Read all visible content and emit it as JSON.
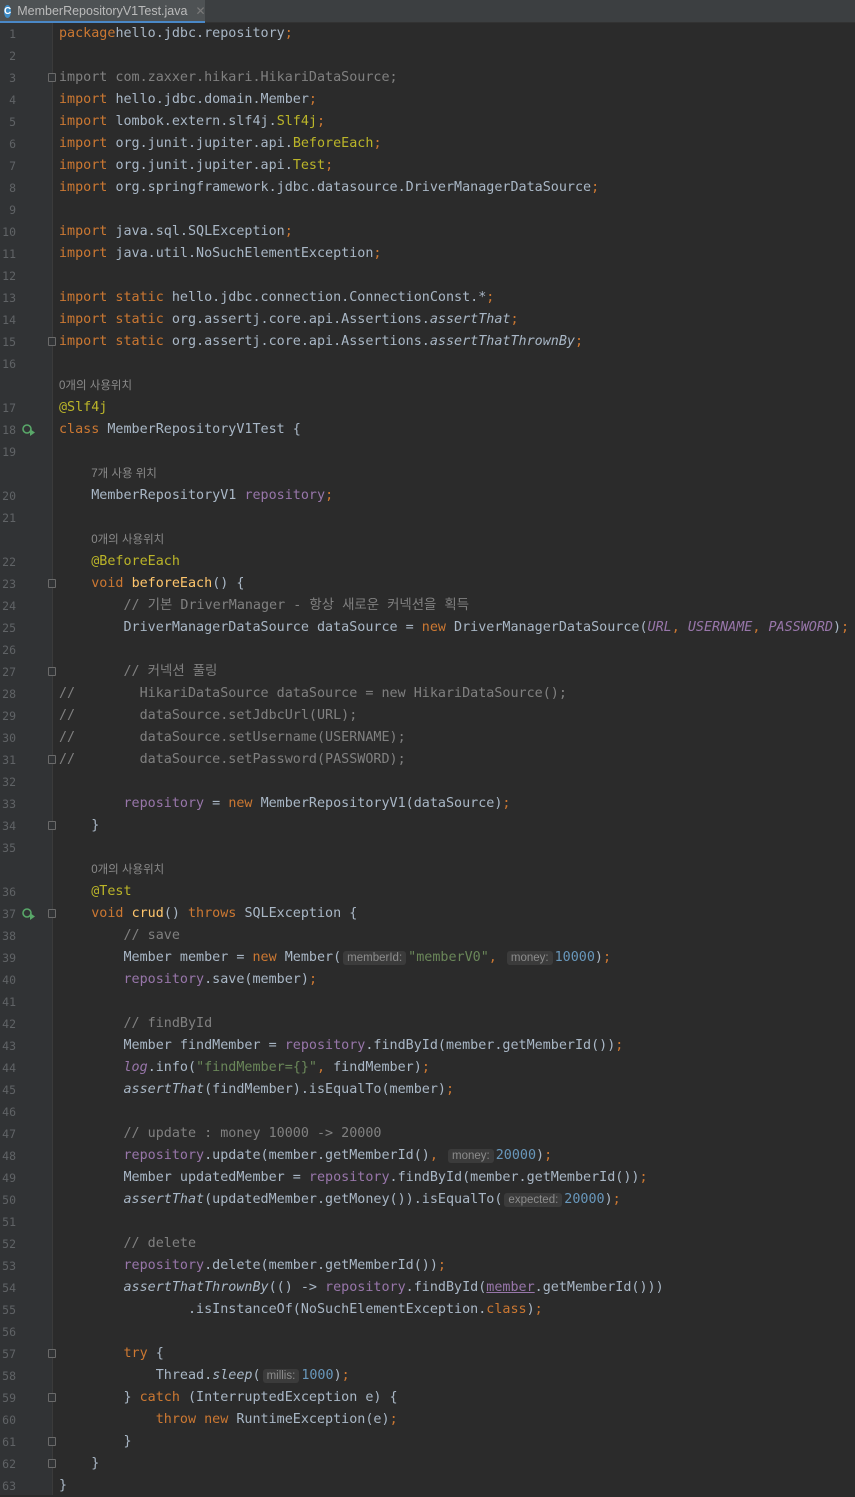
{
  "tab": {
    "title": "MemberRepositoryV1Test.java",
    "icon": "java-class-icon"
  },
  "lines": [
    {
      "n": "1",
      "segs": [
        [
          "kw",
          "package"
        ],
        [
          "",
          "hello.jdbc.repository"
        ],
        [
          "kw",
          ";"
        ]
      ]
    },
    {
      "n": "2",
      "segs": []
    },
    {
      "n": "3",
      "fold": true,
      "segs": [
        [
          "unused",
          "import com.zaxxer.hikari.HikariDataSource;"
        ]
      ]
    },
    {
      "n": "4",
      "segs": [
        [
          "kw",
          "import "
        ],
        [
          "",
          "hello.jdbc.domain.Member"
        ],
        [
          "kw",
          ";"
        ]
      ]
    },
    {
      "n": "5",
      "segs": [
        [
          "kw",
          "import "
        ],
        [
          "",
          "lombok.extern.slf4j."
        ],
        [
          "ann",
          "Slf4j"
        ],
        [
          "kw",
          ";"
        ]
      ]
    },
    {
      "n": "6",
      "segs": [
        [
          "kw",
          "import "
        ],
        [
          "",
          "org.junit.jupiter.api."
        ],
        [
          "ann",
          "BeforeEach"
        ],
        [
          "kw",
          ";"
        ]
      ]
    },
    {
      "n": "7",
      "segs": [
        [
          "kw",
          "import "
        ],
        [
          "",
          "org.junit.jupiter.api."
        ],
        [
          "ann",
          "Test"
        ],
        [
          "kw",
          ";"
        ]
      ]
    },
    {
      "n": "8",
      "segs": [
        [
          "kw",
          "import "
        ],
        [
          "",
          "org.springframework.jdbc.datasource.DriverManagerDataSource"
        ],
        [
          "kw",
          ";"
        ]
      ]
    },
    {
      "n": "9",
      "segs": []
    },
    {
      "n": "10",
      "segs": [
        [
          "kw",
          "import "
        ],
        [
          "",
          "java.sql.SQLException"
        ],
        [
          "kw",
          ";"
        ]
      ]
    },
    {
      "n": "11",
      "segs": [
        [
          "kw",
          "import "
        ],
        [
          "",
          "java.util.NoSuchElementException"
        ],
        [
          "kw",
          ";"
        ]
      ]
    },
    {
      "n": "12",
      "segs": []
    },
    {
      "n": "13",
      "segs": [
        [
          "kw",
          "import static "
        ],
        [
          "",
          "hello.jdbc.connection.ConnectionConst.*"
        ],
        [
          "kw",
          ";"
        ]
      ]
    },
    {
      "n": "14",
      "segs": [
        [
          "kw",
          "import static "
        ],
        [
          "",
          "org.assertj.core.api.Assertions."
        ],
        [
          "ital",
          "assertThat"
        ],
        [
          "kw",
          ";"
        ]
      ]
    },
    {
      "n": "15",
      "fold": true,
      "segs": [
        [
          "kw",
          "import static "
        ],
        [
          "",
          "org.assertj.core.api.Assertions."
        ],
        [
          "ital",
          "assertThatThrownBy"
        ],
        [
          "kw",
          ";"
        ]
      ]
    },
    {
      "n": "16",
      "segs": []
    },
    {
      "hint": "0개의 사용위치",
      "indent": 0
    },
    {
      "n": "17",
      "segs": [
        [
          "ann",
          "@Slf4j"
        ]
      ]
    },
    {
      "n": "18",
      "run": true,
      "segs": [
        [
          "kw",
          "class "
        ],
        [
          "",
          "MemberRepositoryV1Test {"
        ]
      ]
    },
    {
      "n": "19",
      "segs": []
    },
    {
      "hint": "7개 사용 위치",
      "indent": 4
    },
    {
      "n": "20",
      "segs": [
        [
          "",
          "    MemberRepositoryV1 "
        ],
        [
          "fld",
          "repository"
        ],
        [
          "kw",
          ";"
        ]
      ]
    },
    {
      "n": "21",
      "segs": []
    },
    {
      "hint": "0개의 사용위치",
      "indent": 4
    },
    {
      "n": "22",
      "segs": [
        [
          "ann",
          "    @BeforeEach"
        ]
      ]
    },
    {
      "n": "23",
      "fold": true,
      "segs": [
        [
          "kw",
          "    void "
        ],
        [
          "fn",
          "beforeEach"
        ],
        [
          "",
          "() {"
        ]
      ]
    },
    {
      "n": "24",
      "segs": [
        [
          "cmt",
          "        // 기본 DriverManager - 항상 새로운 커넥션을 획득"
        ]
      ]
    },
    {
      "n": "25",
      "segs": [
        [
          "",
          "        DriverManagerDataSource dataSource = "
        ],
        [
          "kw",
          "new "
        ],
        [
          "",
          "DriverManagerDataSource("
        ],
        [
          "cst",
          "URL"
        ],
        [
          "kw",
          ", "
        ],
        [
          "cst",
          "USERNAME"
        ],
        [
          "kw",
          ", "
        ],
        [
          "cst",
          "PASSWORD"
        ],
        [
          "",
          ")"
        ],
        [
          "kw",
          ";"
        ]
      ]
    },
    {
      "n": "26",
      "segs": []
    },
    {
      "n": "27",
      "fold": true,
      "segs": [
        [
          "cmt",
          "        // 커넥션 풀링"
        ]
      ]
    },
    {
      "n": "28",
      "segs": [
        [
          "gcmt",
          "//        HikariDataSource dataSource = new HikariDataSource();"
        ]
      ]
    },
    {
      "n": "29",
      "segs": [
        [
          "gcmt",
          "//        dataSource.setJdbcUrl(URL);"
        ]
      ]
    },
    {
      "n": "30",
      "segs": [
        [
          "gcmt",
          "//        dataSource.setUsername(USERNAME);"
        ]
      ]
    },
    {
      "n": "31",
      "fold": true,
      "segs": [
        [
          "gcmt",
          "//        dataSource.setPassword(PASSWORD);"
        ]
      ]
    },
    {
      "n": "32",
      "segs": []
    },
    {
      "n": "33",
      "segs": [
        [
          "fld",
          "        repository"
        ],
        [
          "",
          " = "
        ],
        [
          "kw",
          "new "
        ],
        [
          "",
          "MemberRepositoryV1(dataSource)"
        ],
        [
          "kw",
          ";"
        ]
      ]
    },
    {
      "n": "34",
      "fold": true,
      "segs": [
        [
          "",
          "    }"
        ]
      ]
    },
    {
      "n": "35",
      "segs": []
    },
    {
      "hint": "0개의 사용위치",
      "indent": 4
    },
    {
      "n": "36",
      "segs": [
        [
          "ann",
          "    @Test"
        ]
      ]
    },
    {
      "n": "37",
      "fold": true,
      "run": true,
      "segs": [
        [
          "kw",
          "    void "
        ],
        [
          "fn",
          "crud"
        ],
        [
          "",
          "() "
        ],
        [
          "kw",
          "throws "
        ],
        [
          "",
          "SQLException {"
        ]
      ]
    },
    {
      "n": "38",
      "segs": [
        [
          "cmt",
          "        // save"
        ]
      ]
    },
    {
      "n": "39",
      "segs": [
        [
          "",
          "        Member member = "
        ],
        [
          "kw",
          "new "
        ],
        [
          "",
          "Member("
        ],
        [
          "pill",
          "memberId:"
        ],
        [
          "str",
          "\"memberV0\""
        ],
        [
          "kw",
          ", "
        ],
        [
          "pill",
          "money:"
        ],
        [
          "num",
          "10000"
        ],
        [
          "",
          ")"
        ],
        [
          "kw",
          ";"
        ]
      ]
    },
    {
      "n": "40",
      "segs": [
        [
          "fld",
          "        repository"
        ],
        [
          "",
          ".save(member)"
        ],
        [
          "kw",
          ";"
        ]
      ]
    },
    {
      "n": "41",
      "segs": []
    },
    {
      "n": "42",
      "segs": [
        [
          "cmt",
          "        // findById"
        ]
      ]
    },
    {
      "n": "43",
      "segs": [
        [
          "",
          "        Member findMember = "
        ],
        [
          "fld",
          "repository"
        ],
        [
          "",
          ".findById(member.getMemberId())"
        ],
        [
          "kw",
          ";"
        ]
      ]
    },
    {
      "n": "44",
      "segs": [
        [
          "cst",
          "        log"
        ],
        [
          "",
          ".info("
        ],
        [
          "str",
          "\"findMember={}\""
        ],
        [
          "kw",
          ", "
        ],
        [
          "",
          "findMember)"
        ],
        [
          "kw",
          ";"
        ]
      ]
    },
    {
      "n": "45",
      "segs": [
        [
          "ital",
          "        assertThat"
        ],
        [
          "",
          "(findMember).isEqualTo(member)"
        ],
        [
          "kw",
          ";"
        ]
      ]
    },
    {
      "n": "46",
      "segs": []
    },
    {
      "n": "47",
      "segs": [
        [
          "cmt",
          "        // update : money 10000 -> 20000"
        ]
      ]
    },
    {
      "n": "48",
      "segs": [
        [
          "fld",
          "        repository"
        ],
        [
          "",
          ".update(member.getMemberId()"
        ],
        [
          "kw",
          ", "
        ],
        [
          "pill",
          "money:"
        ],
        [
          "num",
          "20000"
        ],
        [
          "",
          ")"
        ],
        [
          "kw",
          ";"
        ]
      ]
    },
    {
      "n": "49",
      "segs": [
        [
          "",
          "        Member updatedMember = "
        ],
        [
          "fld",
          "repository"
        ],
        [
          "",
          ".findById(member.getMemberId())"
        ],
        [
          "kw",
          ";"
        ]
      ]
    },
    {
      "n": "50",
      "segs": [
        [
          "ital",
          "        assertThat"
        ],
        [
          "",
          "(updatedMember.getMoney()).isEqualTo("
        ],
        [
          "pill",
          "expected:"
        ],
        [
          "num",
          "20000"
        ],
        [
          "",
          ")"
        ],
        [
          "kw",
          ";"
        ]
      ]
    },
    {
      "n": "51",
      "segs": []
    },
    {
      "n": "52",
      "segs": [
        [
          "cmt",
          "        // delete"
        ]
      ]
    },
    {
      "n": "53",
      "segs": [
        [
          "fld",
          "        repository"
        ],
        [
          "",
          ".delete(member.getMemberId())"
        ],
        [
          "kw",
          ";"
        ]
      ]
    },
    {
      "n": "54",
      "segs": [
        [
          "ital",
          "        assertThatThrownBy"
        ],
        [
          "",
          "(() -> "
        ],
        [
          "fld",
          "repository"
        ],
        [
          "",
          ".findById("
        ],
        [
          "ulfld",
          "member"
        ],
        [
          "",
          ".getMemberId()))"
        ]
      ]
    },
    {
      "n": "55",
      "segs": [
        [
          "",
          "                .isInstanceOf(NoSuchElementException."
        ],
        [
          "kw",
          "class"
        ],
        [
          "",
          ")"
        ],
        [
          "kw",
          ";"
        ]
      ]
    },
    {
      "n": "56",
      "segs": []
    },
    {
      "n": "57",
      "fold": true,
      "segs": [
        [
          "kw",
          "        try "
        ],
        [
          "",
          "{"
        ]
      ]
    },
    {
      "n": "58",
      "segs": [
        [
          "",
          "            Thread."
        ],
        [
          "ital",
          "sleep"
        ],
        [
          "",
          "("
        ],
        [
          "pill",
          "millis:"
        ],
        [
          "num",
          "1000"
        ],
        [
          "",
          ")"
        ],
        [
          "kw",
          ";"
        ]
      ]
    },
    {
      "n": "59",
      "fold": true,
      "segs": [
        [
          "",
          "        } "
        ],
        [
          "kw",
          "catch "
        ],
        [
          "",
          "(InterruptedException e) {"
        ]
      ]
    },
    {
      "n": "60",
      "segs": [
        [
          "kw",
          "            throw new "
        ],
        [
          "",
          "RuntimeException(e)"
        ],
        [
          "kw",
          ";"
        ]
      ]
    },
    {
      "n": "61",
      "fold": true,
      "segs": [
        [
          "",
          "        }"
        ]
      ]
    },
    {
      "n": "62",
      "fold": true,
      "segs": [
        [
          "",
          "    }"
        ]
      ]
    },
    {
      "n": "63",
      "segs": [
        [
          "",
          "}"
        ]
      ]
    }
  ]
}
